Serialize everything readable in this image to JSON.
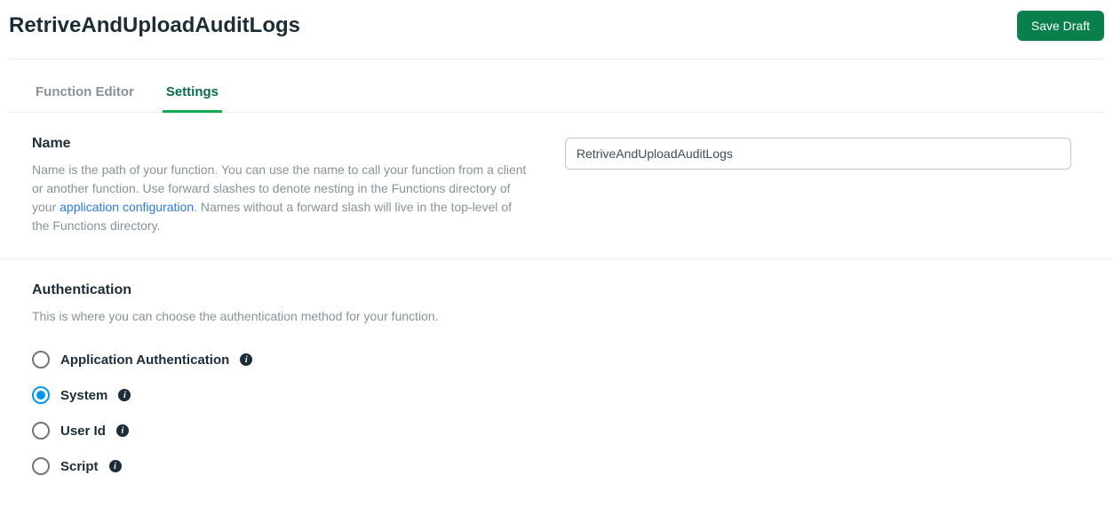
{
  "header": {
    "title": "RetriveAndUploadAuditLogs",
    "save_label": "Save Draft"
  },
  "tabs": {
    "function_editor": "Function Editor",
    "settings": "Settings"
  },
  "name_section": {
    "heading": "Name",
    "desc_part1": "Name is the path of your function. You can use the name to call your function from a client or another function. Use forward slashes to denote nesting in the Functions directory of your ",
    "link_text": "application configuration",
    "desc_part2": ". Names without a forward slash will live in the top-level of the Functions directory.",
    "input_value": "RetriveAndUploadAuditLogs"
  },
  "auth_section": {
    "heading": "Authentication",
    "desc": "This is where you can choose the authentication method for your function.",
    "options": {
      "application": "Application Authentication",
      "system": "System",
      "user_id": "User Id",
      "script": "Script"
    }
  }
}
